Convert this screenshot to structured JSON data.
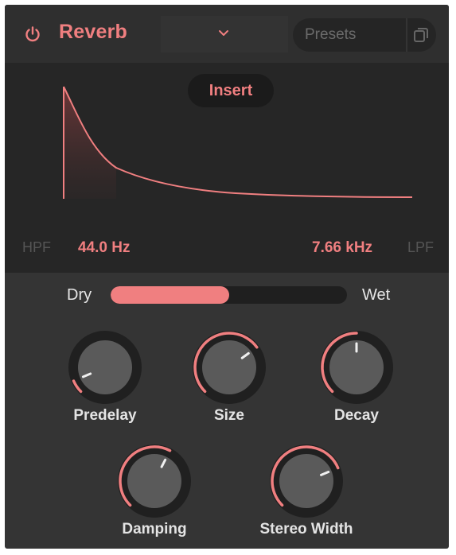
{
  "plugin": {
    "title": "Reverb",
    "accent_color": "#f07f80",
    "power_icon": "power-icon",
    "mode_dropdown_icon": "chevron-down-icon",
    "presets_label": "Presets",
    "presets_icon": "copy-icon"
  },
  "graph": {
    "insert_label": "Insert",
    "hpf_label": "HPF",
    "hpf_value": "44.0 Hz",
    "lpf_label": "LPF",
    "lpf_value": "7.66 kHz"
  },
  "mix": {
    "dry_label": "Dry",
    "wet_label": "Wet",
    "level": 0.5
  },
  "knobs": {
    "predelay": {
      "label": "Predelay",
      "level": 0.08
    },
    "size": {
      "label": "Size",
      "level": 0.7
    },
    "decay": {
      "label": "Decay",
      "level": 0.5
    },
    "damping": {
      "label": "Damping",
      "level": 0.6
    },
    "stereo_width": {
      "label": "Stereo Width",
      "level": 0.75
    }
  }
}
